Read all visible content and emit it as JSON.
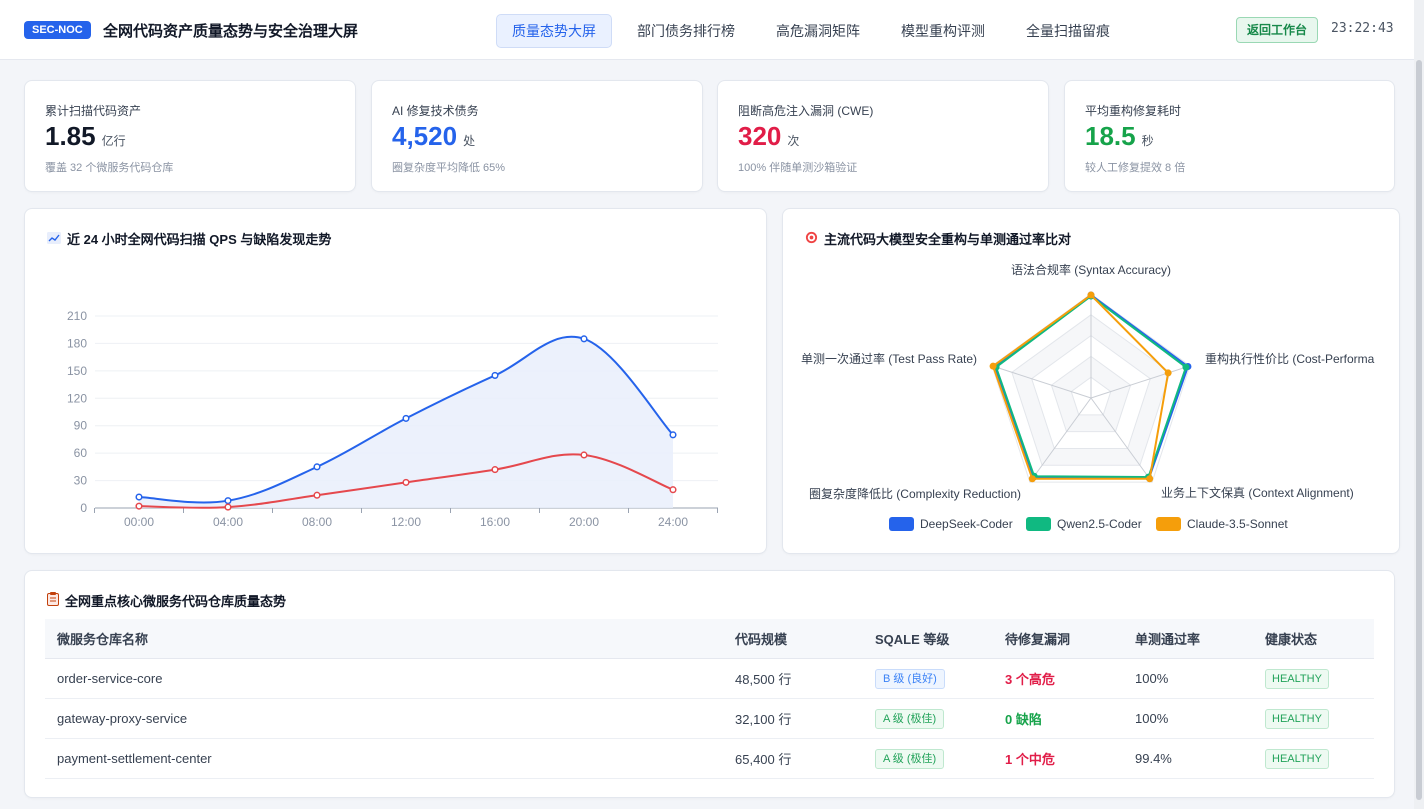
{
  "header": {
    "badge": "SEC-NOC",
    "title": "全网代码资产质量态势与安全治理大屏",
    "tabs": [
      {
        "label": "质量态势大屏",
        "active": true
      },
      {
        "label": "部门债务排行榜",
        "active": false
      },
      {
        "label": "高危漏洞矩阵",
        "active": false
      },
      {
        "label": "模型重构评测",
        "active": false
      },
      {
        "label": "全量扫描留痕",
        "active": false
      }
    ],
    "back_label": "返回工作台",
    "clock": "23:22:43"
  },
  "kpis": [
    {
      "label": "累计扫描代码资产",
      "value": "1.85",
      "unit": "亿行",
      "sub": "覆盖 32 个微服务代码仓库",
      "color": "#111827"
    },
    {
      "label": "AI 修复技术债务",
      "value": "4,520",
      "unit": "处",
      "sub": "圈复杂度平均降低 65%",
      "color": "#2563eb"
    },
    {
      "label": "阻断高危注入漏洞 (CWE)",
      "value": "320",
      "unit": "次",
      "sub": "100% 伴随单测沙箱验证",
      "color": "#e11d48"
    },
    {
      "label": "平均重构修复耗时",
      "value": "18.5",
      "unit": "秒",
      "sub": "较人工修复提效 8 倍",
      "color": "#16a34a"
    }
  ],
  "trend": {
    "title": "近 24 小时全网代码扫描 QPS 与缺陷发现走势",
    "icon": "chart-line-icon"
  },
  "radar": {
    "title": "主流代码大模型安全重构与单测通过率比对",
    "icon": "target-icon"
  },
  "chart_data": [
    {
      "type": "line",
      "title": "近 24 小时全网代码扫描 QPS 与缺陷发现走势",
      "x": [
        "00:00",
        "04:00",
        "08:00",
        "12:00",
        "16:00",
        "20:00",
        "24:00"
      ],
      "ylim": [
        0,
        210
      ],
      "yticks": [
        0,
        30,
        60,
        90,
        120,
        150,
        180,
        210
      ],
      "series": [
        {
          "values": [
            12,
            8,
            45,
            98,
            145,
            185,
            80
          ],
          "color": "#2563eb",
          "area": true
        },
        {
          "values": [
            2,
            1,
            14,
            28,
            42,
            58,
            20
          ],
          "color": "#e5484d",
          "area": false
        }
      ]
    },
    {
      "type": "radar",
      "title": "主流代码大模型安全重构与单测通过率比对",
      "axes": [
        "语法合规率 (Syntax Accuracy)",
        "重构执行性价比 (Cost-Performa",
        "业务上下文保真 (Context Alignment)",
        "圈复杂度降低比 (Complexity Reduction)",
        "单测一次通过率 (Test Pass Rate)"
      ],
      "max": 100,
      "series": [
        {
          "name": "DeepSeek-Coder",
          "color": "#2563eb",
          "values": [
            99,
            98,
            95,
            94,
            97
          ]
        },
        {
          "name": "Qwen2.5-Coder",
          "color": "#10b981",
          "values": [
            98,
            96,
            94,
            93,
            96
          ]
        },
        {
          "name": "Claude-3.5-Sonnet",
          "color": "#f59e0b",
          "values": [
            99,
            78,
            96,
            96,
            99
          ]
        }
      ]
    }
  ],
  "repos": {
    "title": "全网重点核心微服务代码仓库质量态势",
    "icon": "clipboard-icon",
    "columns": [
      "微服务仓库名称",
      "代码规模",
      "SQALE 等级",
      "待修复漏洞",
      "单测通过率",
      "健康状态"
    ],
    "rows": [
      {
        "name": "order-service-core",
        "size": "48,500 行",
        "sqale": "B 级 (良好)",
        "sqale_level": "b",
        "vuln": "3 个高危",
        "vuln_color": "#e11d48",
        "pass": "100%",
        "health": "HEALTHY"
      },
      {
        "name": "gateway-proxy-service",
        "size": "32,100 行",
        "sqale": "A 级 (极佳)",
        "sqale_level": "a",
        "vuln": "0 缺陷",
        "vuln_color": "#16a34a",
        "pass": "100%",
        "health": "HEALTHY"
      },
      {
        "name": "payment-settlement-center",
        "size": "65,400 行",
        "sqale": "A 级 (极佳)",
        "sqale_level": "a",
        "vuln": "1 个中危",
        "vuln_color": "#e11d48",
        "pass": "99.4%",
        "health": "HEALTHY"
      }
    ]
  }
}
